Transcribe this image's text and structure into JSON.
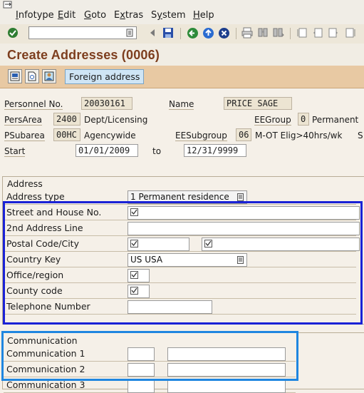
{
  "menu": {
    "items": [
      {
        "label": "Infotype",
        "key": "I"
      },
      {
        "label": "Edit",
        "key": "E"
      },
      {
        "label": "Goto",
        "key": "G"
      },
      {
        "label": "Extras",
        "key": "x"
      },
      {
        "label": "System",
        "key": "y"
      },
      {
        "label": "Help",
        "key": "H"
      }
    ]
  },
  "toolbar": {
    "command_value": "",
    "icons": [
      "enter-icon",
      "back-icon",
      "save-icon",
      "exit-icon",
      "cancel-icon",
      "print-icon",
      "find-icon",
      "find-next-icon",
      "first-page-icon",
      "previous-page-icon",
      "next-page-icon",
      "last-page-icon"
    ]
  },
  "title": "Create Addresses (0006)",
  "app_toolbar": {
    "foreign_address_label": "Foreign address"
  },
  "header": {
    "personnel_no_label": "Personnel No.",
    "personnel_no_value": "20030161",
    "name_label": "Name",
    "name_value": "PRICE SAGE",
    "persarea_label": "PersArea",
    "persarea_value": "2400",
    "persarea_text": "Dept/Licensing",
    "eegroup_label": "EEGroup",
    "eegroup_value": "0",
    "eegroup_text": "Permanent",
    "psubarea_label": "PSubarea",
    "psubarea_value": "00HC",
    "psubarea_text": "Agencywide",
    "eesubgroup_label": "EESubgroup",
    "eesubgroup_value": "06",
    "eesubgroup_text": "M-OT Elig>40hrs/wk",
    "cut_label": "S",
    "start_label": "Start",
    "start_value": "01/01/2009",
    "to_label": "to",
    "end_value": "12/31/9999"
  },
  "address": {
    "group_title": "Address",
    "address_type_label": "Address type",
    "address_type_value": "1 Permanent residence",
    "street_label": "Street and House No.",
    "street_value": "",
    "line2_label": "2nd Address Line",
    "line2_value": "",
    "postal_label": "Postal Code/City",
    "postal_value": "",
    "city_value": "",
    "country_label": "Country Key",
    "country_value": "US USA",
    "office_label": "Office/region",
    "office_value": "",
    "county_label": "County code",
    "county_value": "",
    "phone_label": "Telephone Number",
    "phone_value": ""
  },
  "communication": {
    "group_title": "Communication",
    "comm1_label": "Communication 1",
    "comm2_label": "Communication 2",
    "comm3_label": "Communication 3"
  },
  "colors": {
    "title_text": "#7d3e1e",
    "app_toolbar_bg": "#e8c9a3",
    "highlight_blue": "#1a22d6",
    "highlight_cyan": "#1f86e0",
    "foreign_button_bg": "#cfe5f5"
  }
}
